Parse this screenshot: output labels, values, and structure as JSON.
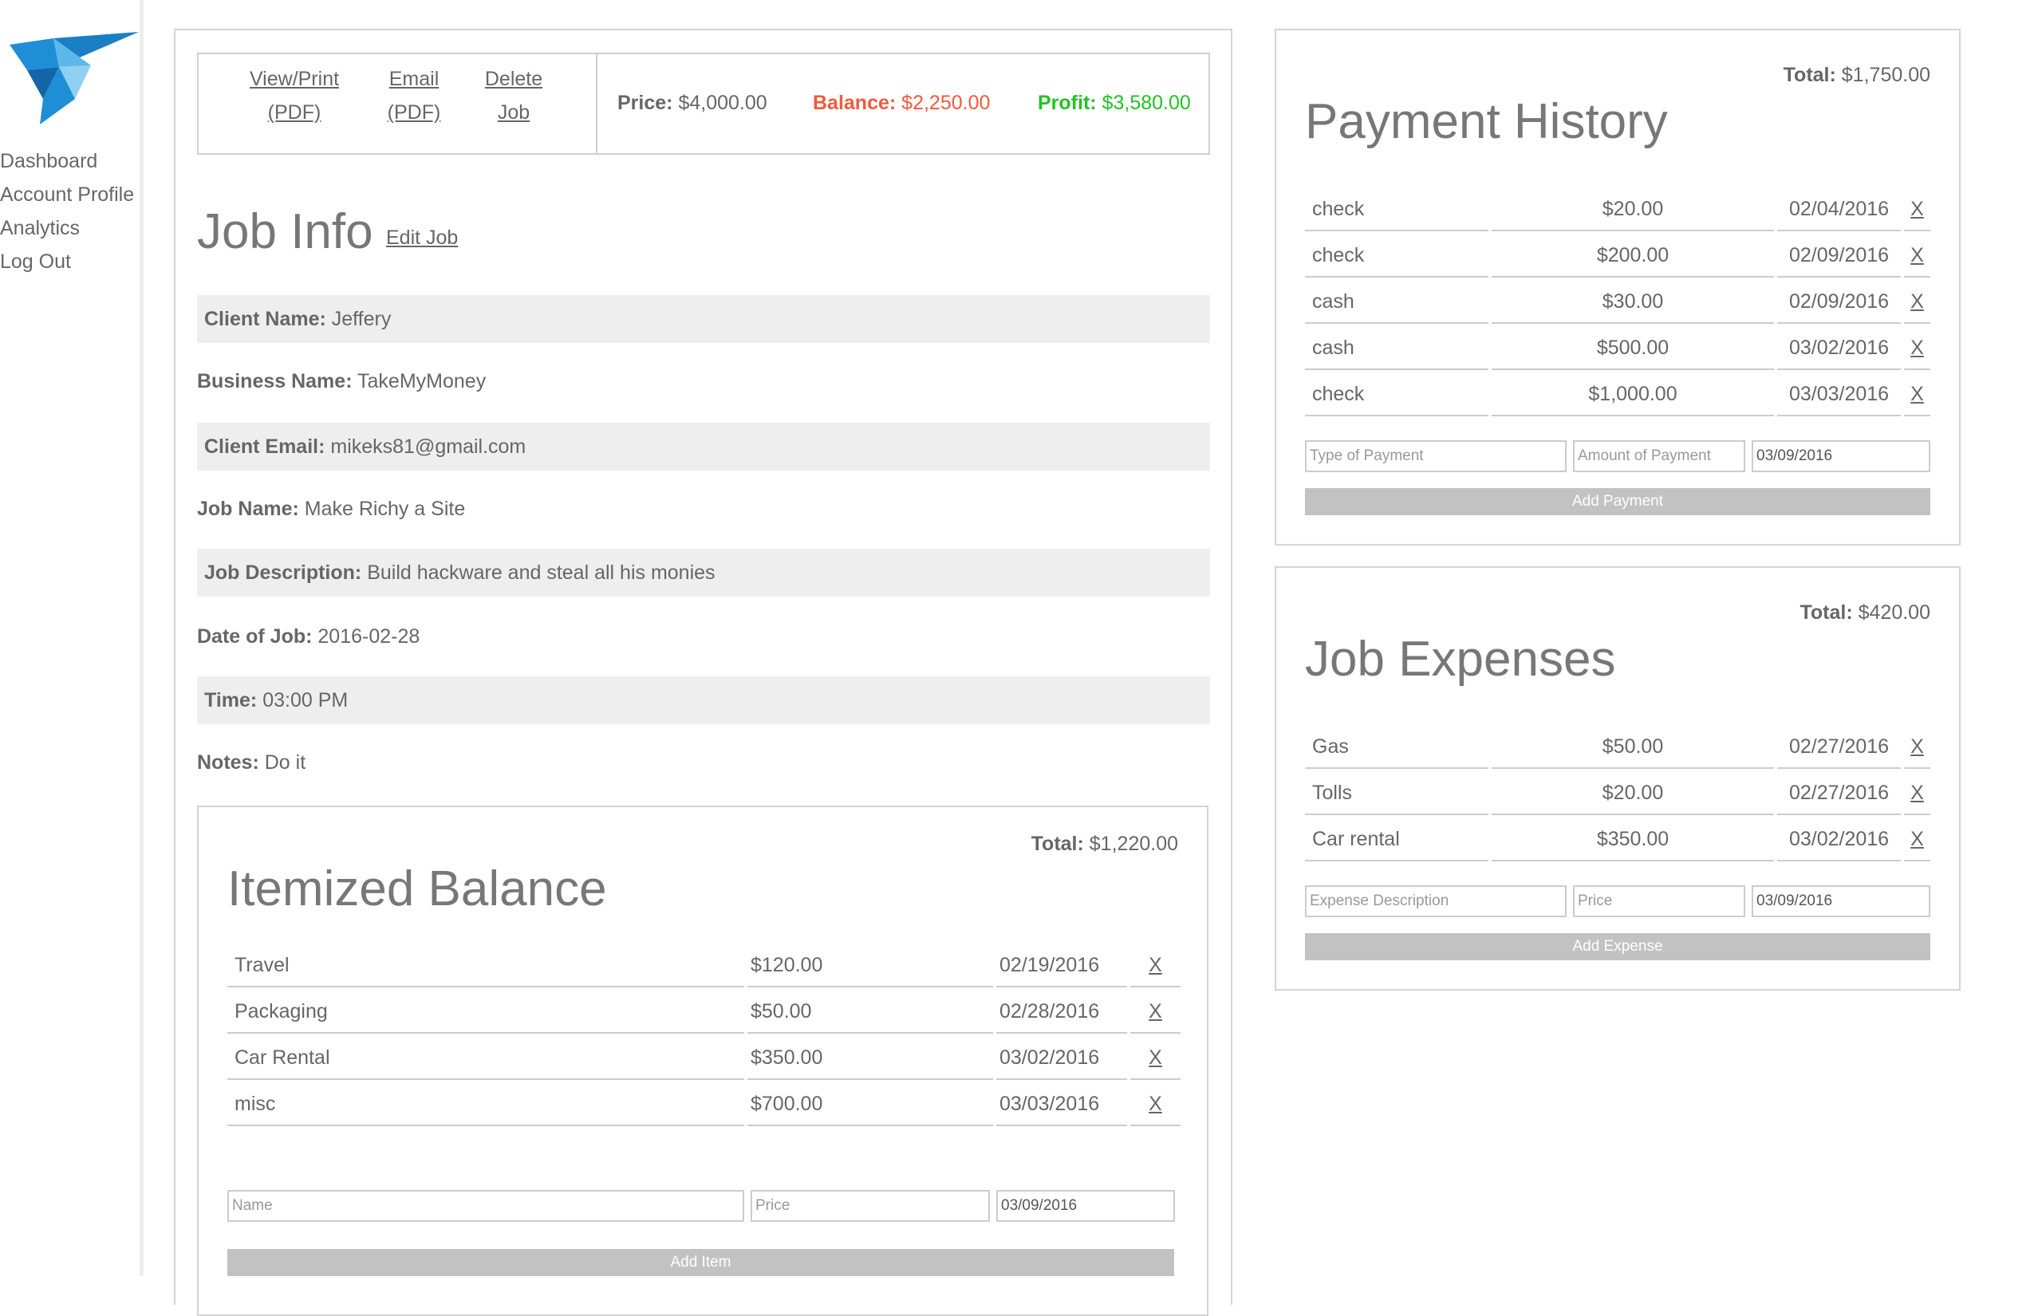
{
  "sidebar": {
    "nav": [
      "Dashboard",
      "Account Profile",
      "Analytics",
      "Log Out"
    ]
  },
  "toolbar": {
    "view_print": [
      "View/Print",
      "(PDF)"
    ],
    "email": [
      "Email",
      "(PDF)"
    ],
    "delete": [
      "Delete",
      "Job"
    ],
    "price_label": "Price:",
    "price_value": "$4,000.00",
    "balance_label": "Balance:",
    "balance_value": "$2,250.00",
    "profit_label": "Profit:",
    "profit_value": "$3,580.00",
    "balance_color": "#f05a3c",
    "profit_color": "#22c322"
  },
  "job_info": {
    "title": "Job Info",
    "edit_link": "Edit Job",
    "fields": [
      {
        "label": "Client Name:",
        "value": "Jeffery"
      },
      {
        "label": "Business Name:",
        "value": "TakeMyMoney"
      },
      {
        "label": "Client Email:",
        "value": "mikeks81@gmail.com"
      },
      {
        "label": "Job Name:",
        "value": "Make Richy a Site"
      },
      {
        "label": "Job Description:",
        "value": "Build hackware and steal all his monies"
      },
      {
        "label": "Date of Job:",
        "value": "2016-02-28"
      },
      {
        "label": "Time:",
        "value": "03:00 PM"
      },
      {
        "label": "Notes:",
        "value": "Do it"
      }
    ]
  },
  "itemized": {
    "total_label": "Total:",
    "total_value": "$1,220.00",
    "title": "Itemized Balance",
    "rows": [
      {
        "name": "Travel",
        "price": "$120.00",
        "date": "02/19/2016",
        "delete": "X"
      },
      {
        "name": "Packaging",
        "price": "$50.00",
        "date": "02/28/2016",
        "delete": "X"
      },
      {
        "name": "Car Rental",
        "price": "$350.00",
        "date": "03/02/2016",
        "delete": "X"
      },
      {
        "name": "misc",
        "price": "$700.00",
        "date": "03/03/2016",
        "delete": "X"
      }
    ],
    "name_placeholder": "Name",
    "price_placeholder": "Price",
    "date_value": "03/09/2016",
    "button": "Add Item"
  },
  "payments": {
    "total_label": "Total:",
    "total_value": "$1,750.00",
    "title": "Payment History",
    "rows": [
      {
        "type": "check",
        "amount": "$20.00",
        "date": "02/04/2016",
        "delete": "X"
      },
      {
        "type": "check",
        "amount": "$200.00",
        "date": "02/09/2016",
        "delete": "X"
      },
      {
        "type": "cash",
        "amount": "$30.00",
        "date": "02/09/2016",
        "delete": "X"
      },
      {
        "type": "cash",
        "amount": "$500.00",
        "date": "03/02/2016",
        "delete": "X"
      },
      {
        "type": "check",
        "amount": "$1,000.00",
        "date": "03/03/2016",
        "delete": "X"
      }
    ],
    "type_placeholder": "Type of Payment",
    "amount_placeholder": "Amount of Payment",
    "date_value": "03/09/2016",
    "button": "Add Payment"
  },
  "expenses": {
    "total_label": "Total:",
    "total_value": "$420.00",
    "title": "Job Expenses",
    "rows": [
      {
        "desc": "Gas",
        "price": "$50.00",
        "date": "02/27/2016",
        "delete": "X"
      },
      {
        "desc": "Tolls",
        "price": "$20.00",
        "date": "02/27/2016",
        "delete": "X"
      },
      {
        "desc": "Car rental",
        "price": "$350.00",
        "date": "03/02/2016",
        "delete": "X"
      }
    ],
    "desc_placeholder": "Expense Description",
    "price_placeholder": "Price",
    "date_value": "03/09/2016",
    "button": "Add Expense"
  }
}
